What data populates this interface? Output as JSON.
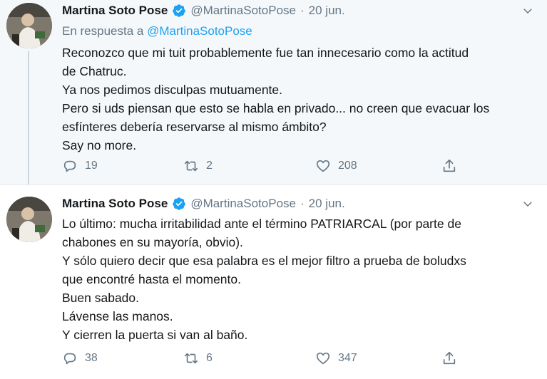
{
  "tweets": [
    {
      "name": "Martina Soto Pose",
      "handle": "@MartinaSotoPose",
      "dot": "·",
      "date": "20 jun.",
      "reply_prefix": "En respuesta a",
      "reply_handle": "@MartinaSotoPose",
      "lines": [
        "Reconozco que mi tuit probablemente fue tan innecesario como la actitud",
        "de Chatruc.",
        "Ya nos pedimos disculpas mutuamente.",
        "Pero si uds piensan que esto se habla en privado... no creen que evacuar los",
        "esfínteres debería reservarse al mismo ámbito?",
        "Say no more."
      ],
      "replies": "19",
      "retweets": "2",
      "likes": "208"
    },
    {
      "name": "Martina Soto Pose",
      "handle": "@MartinaSotoPose",
      "dot": "·",
      "date": "20 jun.",
      "lines": [
        "Lo último: mucha irritabilidad ante el término PATRIARCAL (por parte de",
        "chabones en su mayoría, obvio).",
        "Y sólo quiero decir que esa palabra es el mejor filtro a prueba de boludxs",
        "que encontré hasta el momento.",
        "Buen sabado.",
        "Lávense las manos.",
        "Y cierren la puerta si van al baño."
      ],
      "replies": "38",
      "retweets": "6",
      "likes": "347"
    }
  ],
  "icons": {
    "verified": "verified-badge-icon",
    "menu": "chevron-down-icon",
    "reply": "reply-icon",
    "retweet": "retweet-icon",
    "like": "heart-icon",
    "share": "share-icon"
  },
  "colors": {
    "accent": "#1da1f2",
    "secondary_text": "#657786",
    "primary_text": "#14171a",
    "highlight_background": "#f5f8fa"
  }
}
